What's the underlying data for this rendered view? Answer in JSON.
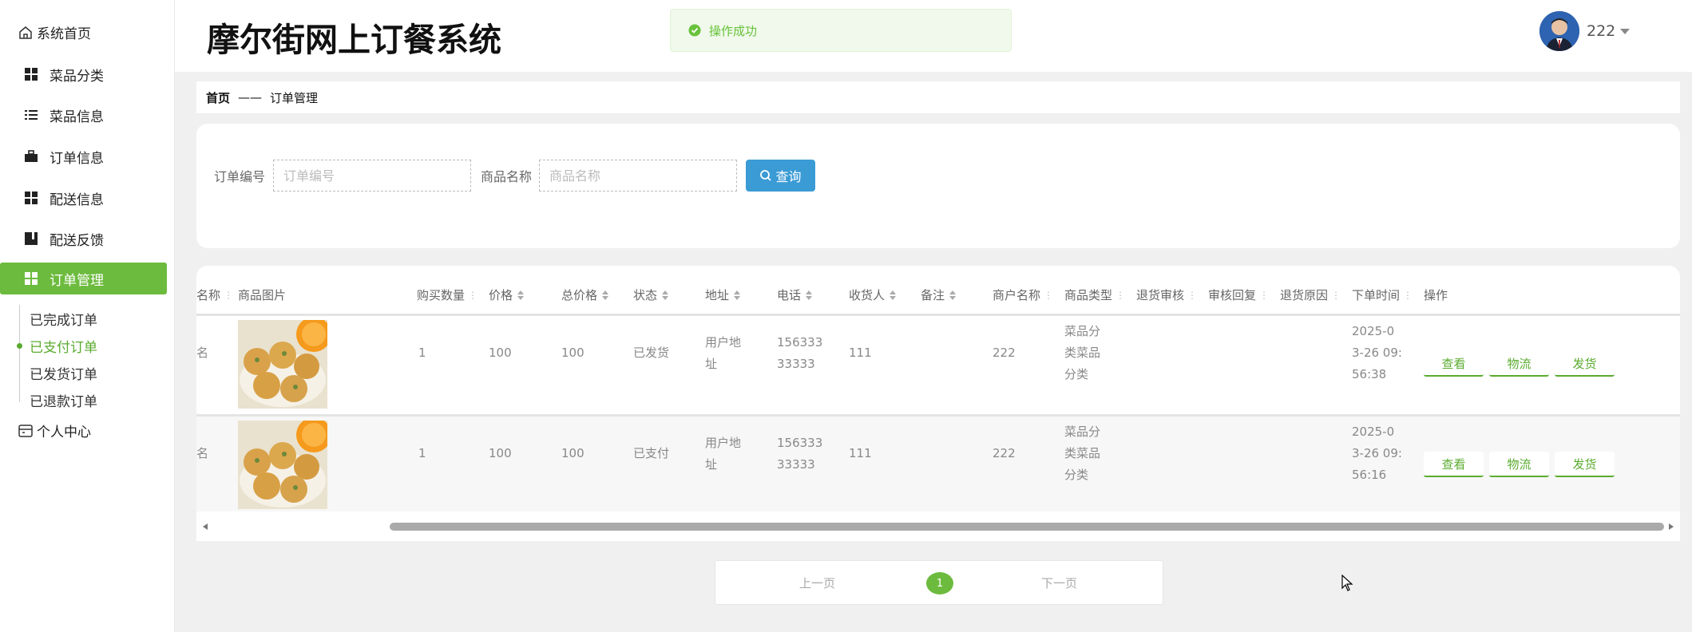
{
  "app": {
    "title": "摩尔街网上订餐系统"
  },
  "toast": {
    "message": "操作成功"
  },
  "user": {
    "name": "222"
  },
  "sidebar": {
    "home": "系统首页",
    "items": [
      {
        "label": "菜品分类",
        "icon": "grid-icon"
      },
      {
        "label": "菜品信息",
        "icon": "list-icon"
      },
      {
        "label": "订单信息",
        "icon": "briefcase-icon"
      },
      {
        "label": "配送信息",
        "icon": "grid-icon"
      },
      {
        "label": "配送反馈",
        "icon": "book-icon"
      },
      {
        "label": "订单管理",
        "icon": "grid-icon"
      }
    ],
    "sub_items": [
      "已完成订单",
      "已支付订单",
      "已发货订单",
      "已退款订单"
    ],
    "personal": "个人中心"
  },
  "breadcrumb": {
    "home": "首页",
    "sep": "——",
    "current": "订单管理"
  },
  "search": {
    "order_no_label": "订单编号",
    "order_no_placeholder": "订单编号",
    "product_label": "商品名称",
    "product_placeholder": "商品名称",
    "button": "查询"
  },
  "table": {
    "headers": [
      "名称",
      "商品图片",
      "购买数量",
      "价格",
      "总价格",
      "状态",
      "地址",
      "电话",
      "收货人",
      "备注",
      "商户名称",
      "商品类型",
      "退货审核",
      "审核回复",
      "退货原因",
      "下单时间",
      "操作"
    ],
    "rows": [
      {
        "name": "名",
        "qty": "1",
        "price": "100",
        "total": "100",
        "status": "已发货",
        "address": [
          "用户地",
          "址"
        ],
        "phone": [
          "156333",
          "33333"
        ],
        "receiver": "111",
        "merchant": "222",
        "category": [
          "菜品分",
          "类菜品",
          "分类"
        ],
        "time": [
          "2025-0",
          "3-26 09:",
          "56:38"
        ]
      },
      {
        "name": "名",
        "qty": "1",
        "price": "100",
        "total": "100",
        "status": "已支付",
        "address": [
          "用户地",
          "址"
        ],
        "phone": [
          "156333",
          "33333"
        ],
        "receiver": "111",
        "merchant": "222",
        "category": [
          "菜品分",
          "类菜品",
          "分类"
        ],
        "time": [
          "2025-0",
          "3-26 09:",
          "56:16"
        ]
      }
    ],
    "actions": [
      "查看",
      "物流",
      "发货"
    ]
  },
  "pager": {
    "prev": "上一页",
    "current": "1",
    "next": "下一页"
  },
  "colors": {
    "accent": "#6dbb3e",
    "button_blue": "#3a9bd5",
    "toast_bg": "#f0f9eb",
    "toast_text": "#67c23a"
  }
}
